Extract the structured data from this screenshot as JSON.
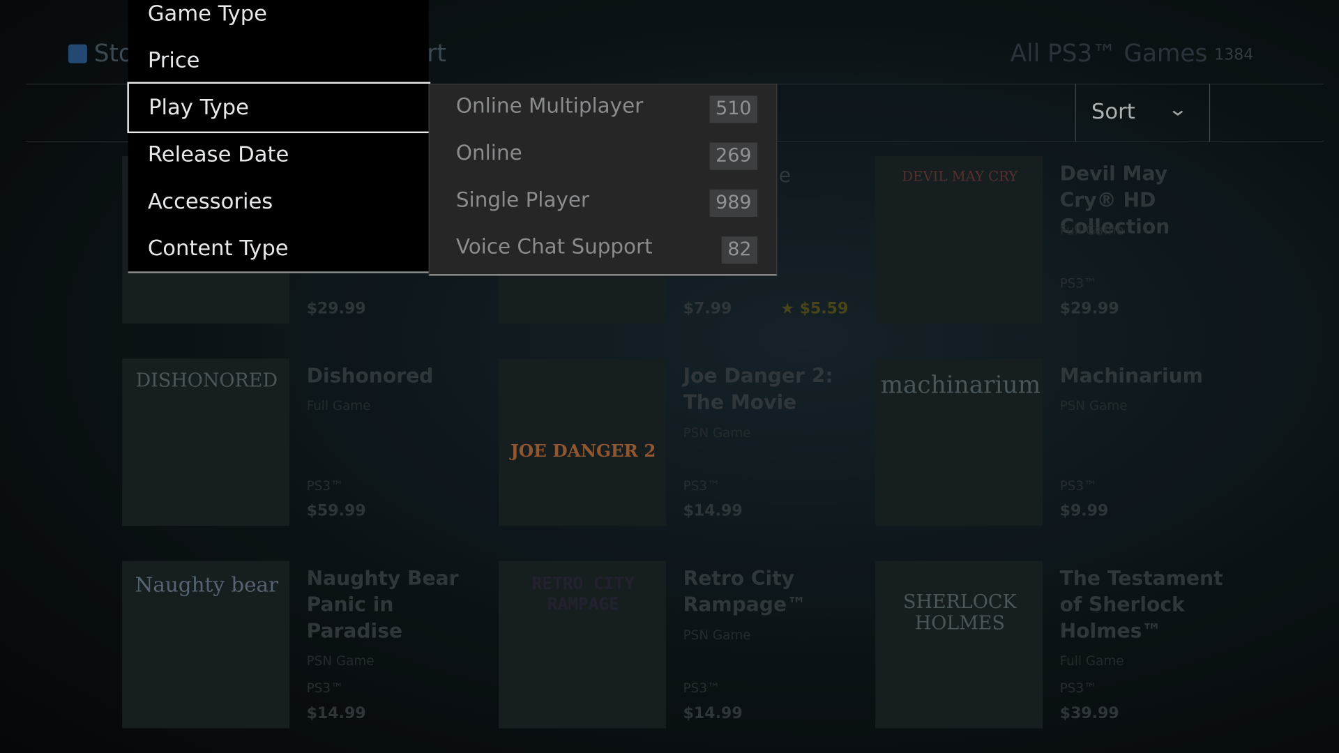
{
  "header": {
    "store_label": "Sto",
    "middle_fragment": "rt",
    "category_title": "All PS3™ Games",
    "category_count": "1384"
  },
  "sort": {
    "label": "Sort",
    "chevron_icon": "chevron-down-icon"
  },
  "filter_menu": {
    "items": [
      {
        "label": "Game Type"
      },
      {
        "label": "Price"
      },
      {
        "label": "Play Type"
      },
      {
        "label": "Release Date"
      },
      {
        "label": "Accessories"
      },
      {
        "label": "Content Type"
      }
    ],
    "selected": "Play Type"
  },
  "play_type_submenu": {
    "options": [
      {
        "label": "Online Multiplayer",
        "count": "510"
      },
      {
        "label": "Online",
        "count": "269"
      },
      {
        "label": "Single Player",
        "count": "989"
      },
      {
        "label": "Voice Chat Support",
        "count": "82"
      }
    ]
  },
  "games": {
    "top_row": [
      {
        "price": "$29.99"
      },
      {
        "title_fragment": "e",
        "price": "$7.99",
        "sale_price": "★ $5.59"
      },
      {
        "title": "Devil May Cry® HD Collection",
        "type": "Full Game",
        "platform": "PS3™",
        "price": "$29.99",
        "thumb_text": "DEVIL MAY CRY"
      }
    ],
    "row2": [
      {
        "title": "Dishonored",
        "type": "Full Game",
        "platform": "PS3™",
        "price": "$59.99",
        "thumb_text": "DISHONORED"
      },
      {
        "title": "Joe Danger 2: The Movie",
        "type": "PSN Game",
        "platform": "PS3™",
        "price": "$14.99",
        "thumb_text": "JOE DANGER 2"
      },
      {
        "title": "Machinarium",
        "type": "PSN Game",
        "platform": "PS3™",
        "price": "$9.99",
        "thumb_text": "machinarium"
      }
    ],
    "row3": [
      {
        "title": "Naughty Bear Panic in Paradise",
        "type": "PSN Game",
        "platform": "PS3™",
        "price": "$14.99",
        "thumb_text": "Naughty bear"
      },
      {
        "title": "Retro City Rampage™",
        "type": "PSN Game",
        "platform": "PS3™",
        "price": "$14.99",
        "thumb_text": "RETRO CITY RAMPAGE"
      },
      {
        "title": "The Testament of Sherlock Holmes™",
        "type": "Full Game",
        "platform": "PS3™",
        "price": "$39.99",
        "thumb_text": "SHERLOCK HOLMES"
      }
    ]
  }
}
